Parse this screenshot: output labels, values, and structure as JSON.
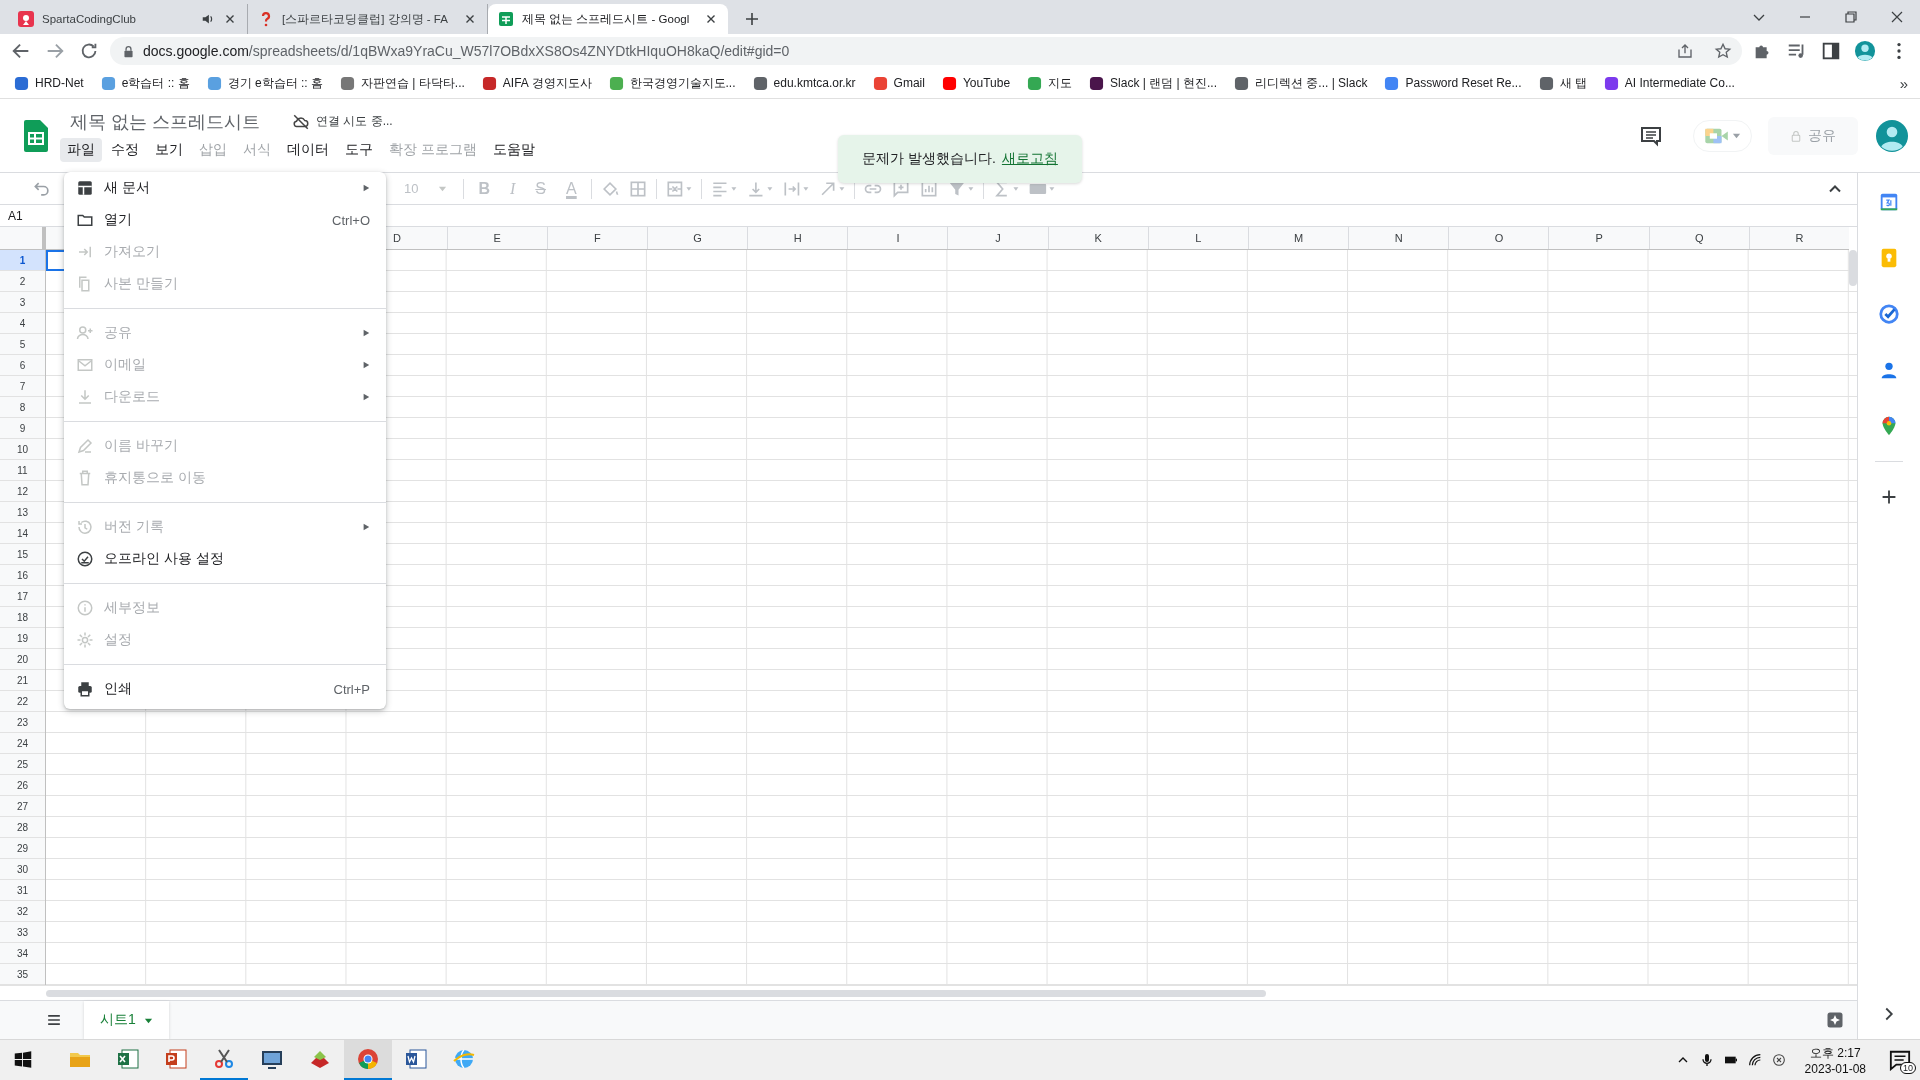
{
  "browser": {
    "tabs": [
      {
        "kind": "logo",
        "title": "SpartaCodingClub",
        "audio": true,
        "selected": false
      },
      {
        "kind": "question",
        "title": "[스파르타코딩클럽] 강의명 - FA",
        "audio": false,
        "selected": false
      },
      {
        "kind": "sheets",
        "title": "제목 없는 스프레드시트 - Googl",
        "audio": false,
        "selected": true
      }
    ],
    "url": {
      "host": "docs.google.com",
      "path": "/spreadsheets/d/1qBWxa9YraCu_W57l7OBdxXS8Os4ZNYDtkHIquOH8kaQ/edit#gid=0"
    },
    "bookmarks": [
      {
        "label": "HRD-Net"
      },
      {
        "label": "e학습터 :: 홈"
      },
      {
        "label": "경기 e학습터 :: 홈"
      },
      {
        "label": "자판연습 | 타닥타..."
      },
      {
        "label": "AIFA 경영지도사"
      },
      {
        "label": "한국경영기술지도..."
      },
      {
        "label": "edu.kmtca.or.kr"
      },
      {
        "label": "Gmail"
      },
      {
        "label": "YouTube"
      },
      {
        "label": "지도"
      },
      {
        "label": "Slack | 랜덤 | 현진..."
      },
      {
        "label": "리디렉션 중... | Slack"
      },
      {
        "label": "Password Reset Re..."
      },
      {
        "label": "새 탭"
      },
      {
        "label": "AI Intermediate Co..."
      }
    ],
    "more": "»"
  },
  "sheets": {
    "title": "제목 없는 스프레드시트",
    "status": "연결 시도 중...",
    "share": "공유",
    "menus": [
      {
        "label": "파일",
        "selected": true,
        "disabled": false
      },
      {
        "label": "수정",
        "selected": false,
        "disabled": false
      },
      {
        "label": "보기",
        "selected": false,
        "disabled": false
      },
      {
        "label": "삽입",
        "selected": false,
        "disabled": true
      },
      {
        "label": "서식",
        "selected": false,
        "disabled": true
      },
      {
        "label": "데이터",
        "selected": false,
        "disabled": false
      },
      {
        "label": "도구",
        "selected": false,
        "disabled": false
      },
      {
        "label": "확장 프로그램",
        "selected": false,
        "disabled": true
      },
      {
        "label": "도움말",
        "selected": false,
        "disabled": false
      }
    ],
    "toolbar": {
      "font_size": "10",
      "format": [
        {
          "kind": "bold",
          "label": "B"
        },
        {
          "kind": "italic",
          "label": "I"
        },
        {
          "kind": "strike",
          "label": "S"
        },
        {
          "kind": "color",
          "label": "A"
        }
      ]
    },
    "name_box": "A1",
    "columns": [
      {
        "label": "D"
      },
      {
        "label": "E"
      },
      {
        "label": "F"
      },
      {
        "label": "G"
      },
      {
        "label": "H"
      },
      {
        "label": "I"
      },
      {
        "label": "J"
      },
      {
        "label": "K"
      },
      {
        "label": "L"
      },
      {
        "label": "M"
      },
      {
        "label": "N"
      },
      {
        "label": "O"
      },
      {
        "label": "P"
      },
      {
        "label": "Q"
      },
      {
        "label": "R"
      }
    ],
    "rows": [
      {
        "label": "1",
        "selected": true
      },
      {
        "label": "2",
        "selected": false
      },
      {
        "label": "3",
        "selected": false
      },
      {
        "label": "4",
        "selected": false
      },
      {
        "label": "5",
        "selected": false
      },
      {
        "label": "6",
        "selected": false
      },
      {
        "label": "7",
        "selected": false
      },
      {
        "label": "8",
        "selected": false
      },
      {
        "label": "9",
        "selected": false
      },
      {
        "label": "10",
        "selected": false
      },
      {
        "label": "11",
        "selected": false
      },
      {
        "label": "12",
        "selected": false
      },
      {
        "label": "13",
        "selected": false
      },
      {
        "label": "14",
        "selected": false
      },
      {
        "label": "15",
        "selected": false
      },
      {
        "label": "16",
        "selected": false
      },
      {
        "label": "17",
        "selected": false
      },
      {
        "label": "18",
        "selected": false
      },
      {
        "label": "19",
        "selected": false
      },
      {
        "label": "20",
        "selected": false
      },
      {
        "label": "21",
        "selected": false
      },
      {
        "label": "22",
        "selected": false
      },
      {
        "label": "23",
        "selected": false
      },
      {
        "label": "24",
        "selected": false
      },
      {
        "label": "25",
        "selected": false
      },
      {
        "label": "26",
        "selected": false
      },
      {
        "label": "27",
        "selected": false
      },
      {
        "label": "28",
        "selected": false
      },
      {
        "label": "29",
        "selected": false
      },
      {
        "label": "30",
        "selected": false
      },
      {
        "label": "31",
        "selected": false
      },
      {
        "label": "32",
        "selected": false
      },
      {
        "label": "33",
        "selected": false
      },
      {
        "label": "34",
        "selected": false
      },
      {
        "label": "35",
        "selected": false
      }
    ],
    "sheet_tabs": [
      {
        "label": "시트1",
        "selected": true
      }
    ],
    "file_menu": [
      [
        {
          "kind": "new",
          "label": "새 문서",
          "disabled": false,
          "submenu": true
        },
        {
          "kind": "folder",
          "label": "열기",
          "shortcut": "Ctrl+O",
          "disabled": false,
          "submenu": false
        },
        {
          "kind": "import",
          "label": "가져오기",
          "disabled": true,
          "submenu": false
        },
        {
          "kind": "copy",
          "label": "사본 만들기",
          "disabled": true,
          "submenu": false
        }
      ],
      [
        {
          "kind": "share",
          "label": "공유",
          "disabled": true,
          "submenu": true
        },
        {
          "kind": "mail",
          "label": "이메일",
          "disabled": true,
          "submenu": true
        },
        {
          "kind": "download",
          "label": "다운로드",
          "disabled": true,
          "submenu": true
        }
      ],
      [
        {
          "kind": "rename",
          "label": "이름 바꾸기",
          "disabled": true,
          "submenu": false
        },
        {
          "kind": "trash",
          "label": "휴지통으로 이동",
          "disabled": true,
          "submenu": false
        }
      ],
      [
        {
          "kind": "history",
          "label": "버전 기록",
          "disabled": true,
          "submenu": true
        },
        {
          "kind": "offline",
          "label": "오프라인 사용 설정",
          "disabled": false,
          "submenu": false
        }
      ],
      [
        {
          "kind": "info",
          "label": "세부정보",
          "disabled": true,
          "submenu": false
        },
        {
          "kind": "settings",
          "label": "설정",
          "disabled": true,
          "submenu": false
        }
      ],
      [
        {
          "kind": "print",
          "label": "인쇄",
          "shortcut": "Ctrl+P",
          "disabled": false,
          "submenu": false
        }
      ]
    ],
    "toast": {
      "message": "문제가 발생했습니다.",
      "link": "새로고침"
    }
  },
  "taskbar": {
    "apps": [
      {
        "kind": "folder",
        "running": false,
        "selected": false
      },
      {
        "kind": "spreadsheet",
        "running": false,
        "selected": false
      },
      {
        "kind": "presentation",
        "running": false,
        "selected": false
      },
      {
        "kind": "scissors",
        "running": true,
        "selected": false
      },
      {
        "kind": "monitor",
        "running": false,
        "selected": false
      },
      {
        "kind": "stack",
        "running": false,
        "selected": false
      },
      {
        "kind": "browser",
        "running": true,
        "selected": true
      },
      {
        "kind": "document",
        "running": false,
        "selected": false
      },
      {
        "kind": "globe",
        "running": false,
        "selected": false
      }
    ],
    "time": "오후 2:17",
    "date": "2023-01-08",
    "notifications": "10"
  }
}
